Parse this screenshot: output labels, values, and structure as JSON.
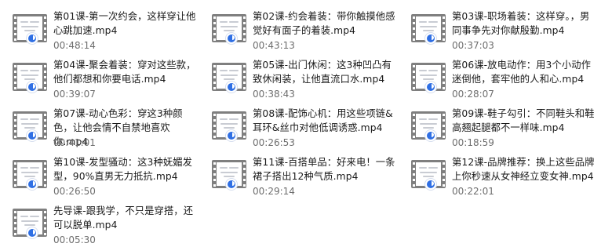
{
  "files": [
    {
      "name": "第01课-第一次约会，这样穿让他心跳加速.mp4",
      "duration": "00:48:14",
      "thumb_icon": "video-thumbnail-icon"
    },
    {
      "name": "第02课-约会着装：带你触摸他感觉好有面子的着装.mp4",
      "duration": "00:43:13",
      "thumb_icon": "video-thumbnail-icon"
    },
    {
      "name": "第03课-职场着装：这样穿。，男同事争先对你献殷勤.mp4",
      "duration": "00:37:03",
      "thumb_icon": "video-thumbnail-icon"
    },
    {
      "name": "第04课-聚会着装：穿对这些款，他们都想和你要电话.mp4",
      "duration": "00:39:07",
      "thumb_icon": "video-thumbnail-icon"
    },
    {
      "name": "第05课-出门休闲：这3种凹凸有致休闲装，让他直流口水.mp4",
      "duration": "00:38:43",
      "thumb_icon": "video-thumbnail-icon"
    },
    {
      "name": "第06课-放电动作：用3个小动作迷倒他，套牢他的人和心.mp4",
      "duration": "00:28:07",
      "thumb_icon": "video-thumbnail-icon"
    },
    {
      "name": "第07课-动心色彩：穿这3种颜色，让他会情不自禁地喜欢你.mp4",
      "duration": "00:41:01",
      "thumb_icon": "video-thumbnail-icon"
    },
    {
      "name": "第08课-配饰心机：用这些项链&耳环&丝巾对他低调诱惑.mp4",
      "duration": "00:26:53",
      "thumb_icon": "video-thumbnail-icon"
    },
    {
      "name": "第09课-鞋子勾引：不同鞋头和鞋高翘起腿都不一样味.mp4",
      "duration": "00:18:59",
      "thumb_icon": "video-thumbnail-icon"
    },
    {
      "name": "第10课-发型骚动：这3种妩媚发型，90%直男无力抵抗.mp4",
      "duration": "00:26:50",
      "thumb_icon": "video-thumbnail-icon"
    },
    {
      "name": "第11课-百搭单品：好来电！一条裙子搭出12种气质.mp4",
      "duration": "00:29:14",
      "thumb_icon": "video-thumbnail-icon"
    },
    {
      "name": "第12课-品牌推荐：换上这些品牌上你秒速从女神经立变女神.mp4",
      "duration": "00:22:01",
      "thumb_icon": "video-thumbnail-icon"
    },
    {
      "name": "先导课-跟我学，不只是穿搭，还可以脱单.mp4",
      "duration": "00:05:30",
      "thumb_icon": "video-thumbnail-icon"
    }
  ],
  "colors": {
    "filename_text": "#1a1a1a",
    "duration_text": "#6e6e6e",
    "film_strip": "#7f7f7f",
    "badge_blue": "#2f6fe4",
    "background": "#ffffff"
  }
}
